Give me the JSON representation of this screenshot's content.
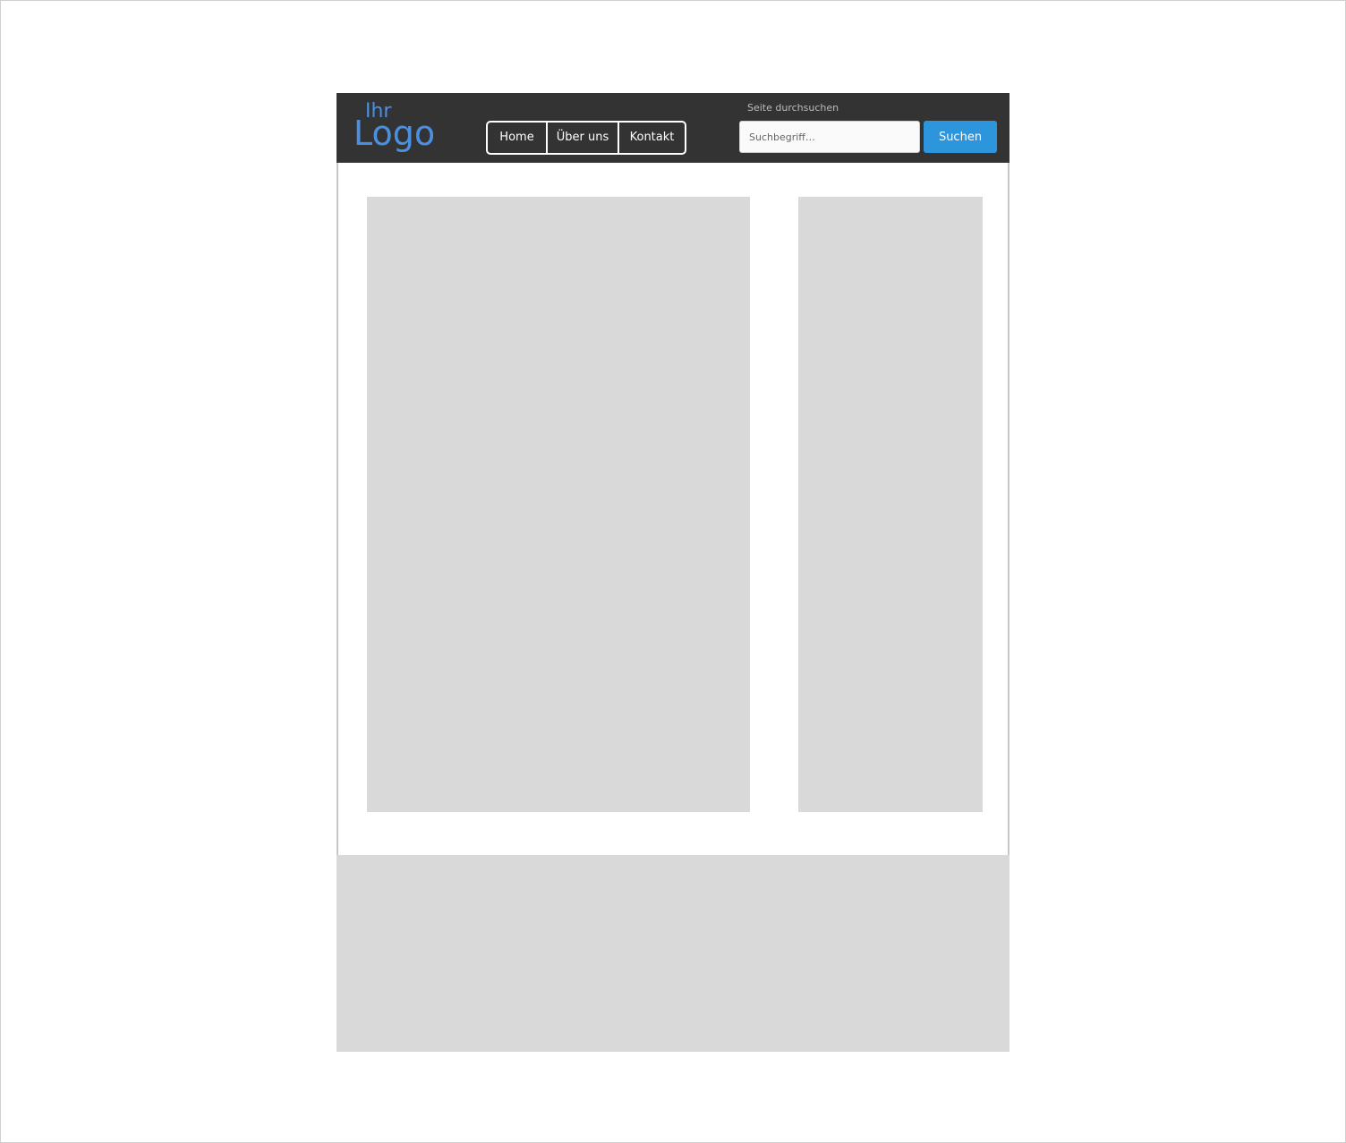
{
  "header": {
    "logo": {
      "line1": "Ihr",
      "line2": "Logo"
    },
    "nav": [
      {
        "label": "Home"
      },
      {
        "label": "Über uns"
      },
      {
        "label": "Kontakt"
      }
    ],
    "search": {
      "label": "Seite durchsuchen",
      "placeholder": "Suchbegriff…",
      "value": "",
      "button_label": "Suchen"
    }
  },
  "colors": {
    "header_bg": "#333333",
    "logo": "#4a90e2",
    "search_button": "#2d95dc",
    "placeholder_block": "#d9d9d9"
  }
}
